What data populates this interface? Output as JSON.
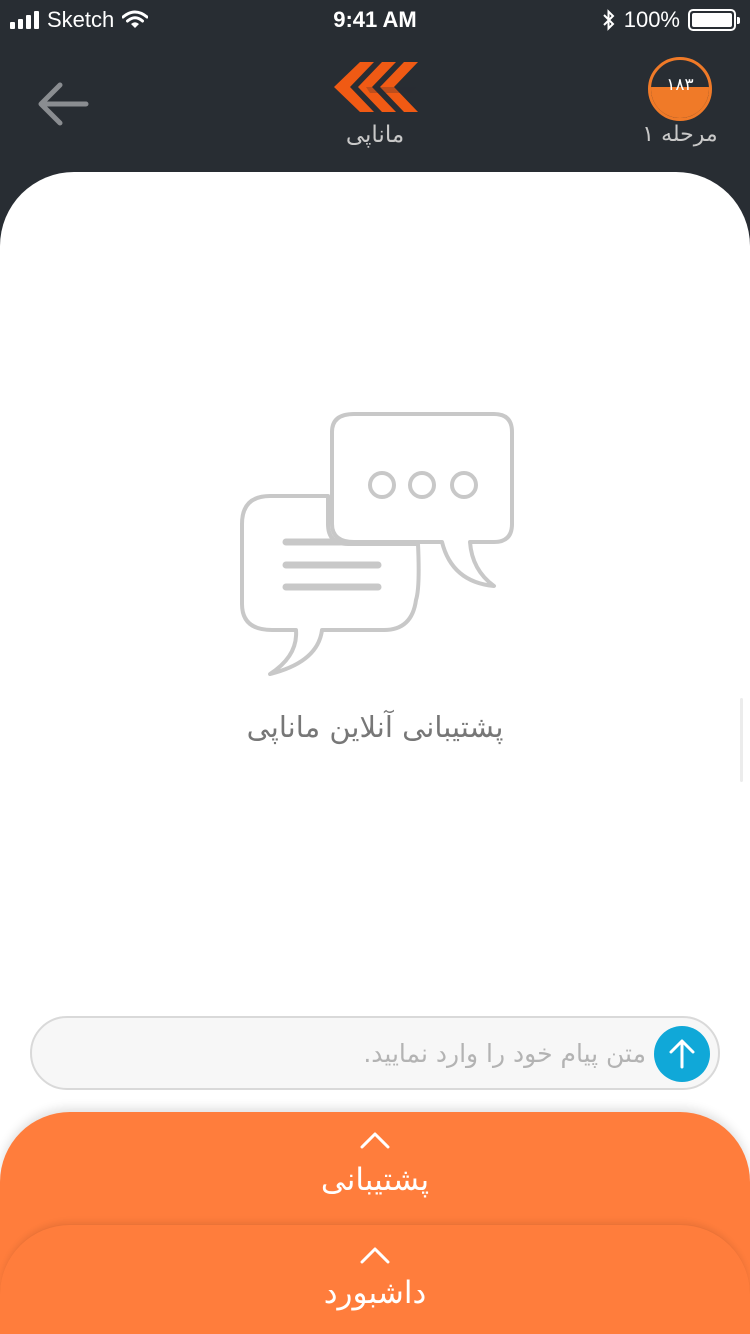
{
  "status_bar": {
    "carrier": "Sketch",
    "time": "9:41 AM",
    "battery": "100%",
    "icons": [
      "signal-icon",
      "wifi-icon",
      "bluetooth-icon",
      "battery-icon"
    ]
  },
  "header": {
    "back_icon": "arrow-left-icon",
    "logo_icon": "chevrons-logo-icon",
    "app_name": "ماناپی",
    "level_number": "۱۸۳",
    "level_label": "مرحله ۱"
  },
  "empty_state": {
    "icon": "chat-bubbles-icon",
    "title": "پشتیبانی آنلاین ماناپی"
  },
  "composer": {
    "value": "",
    "placeholder": "متن پیام خود را وارد نمایید.",
    "send_icon": "arrow-up-icon"
  },
  "panels": {
    "support_label": "پشتیبانی",
    "dashboard_label": "داشبورد",
    "chevron_icon": "chevron-up-icon"
  },
  "colors": {
    "header_bg": "#282d33",
    "accent_orange": "#ff7d3c",
    "logo_orange": "#f05a14",
    "send_blue": "#10a8d8"
  }
}
